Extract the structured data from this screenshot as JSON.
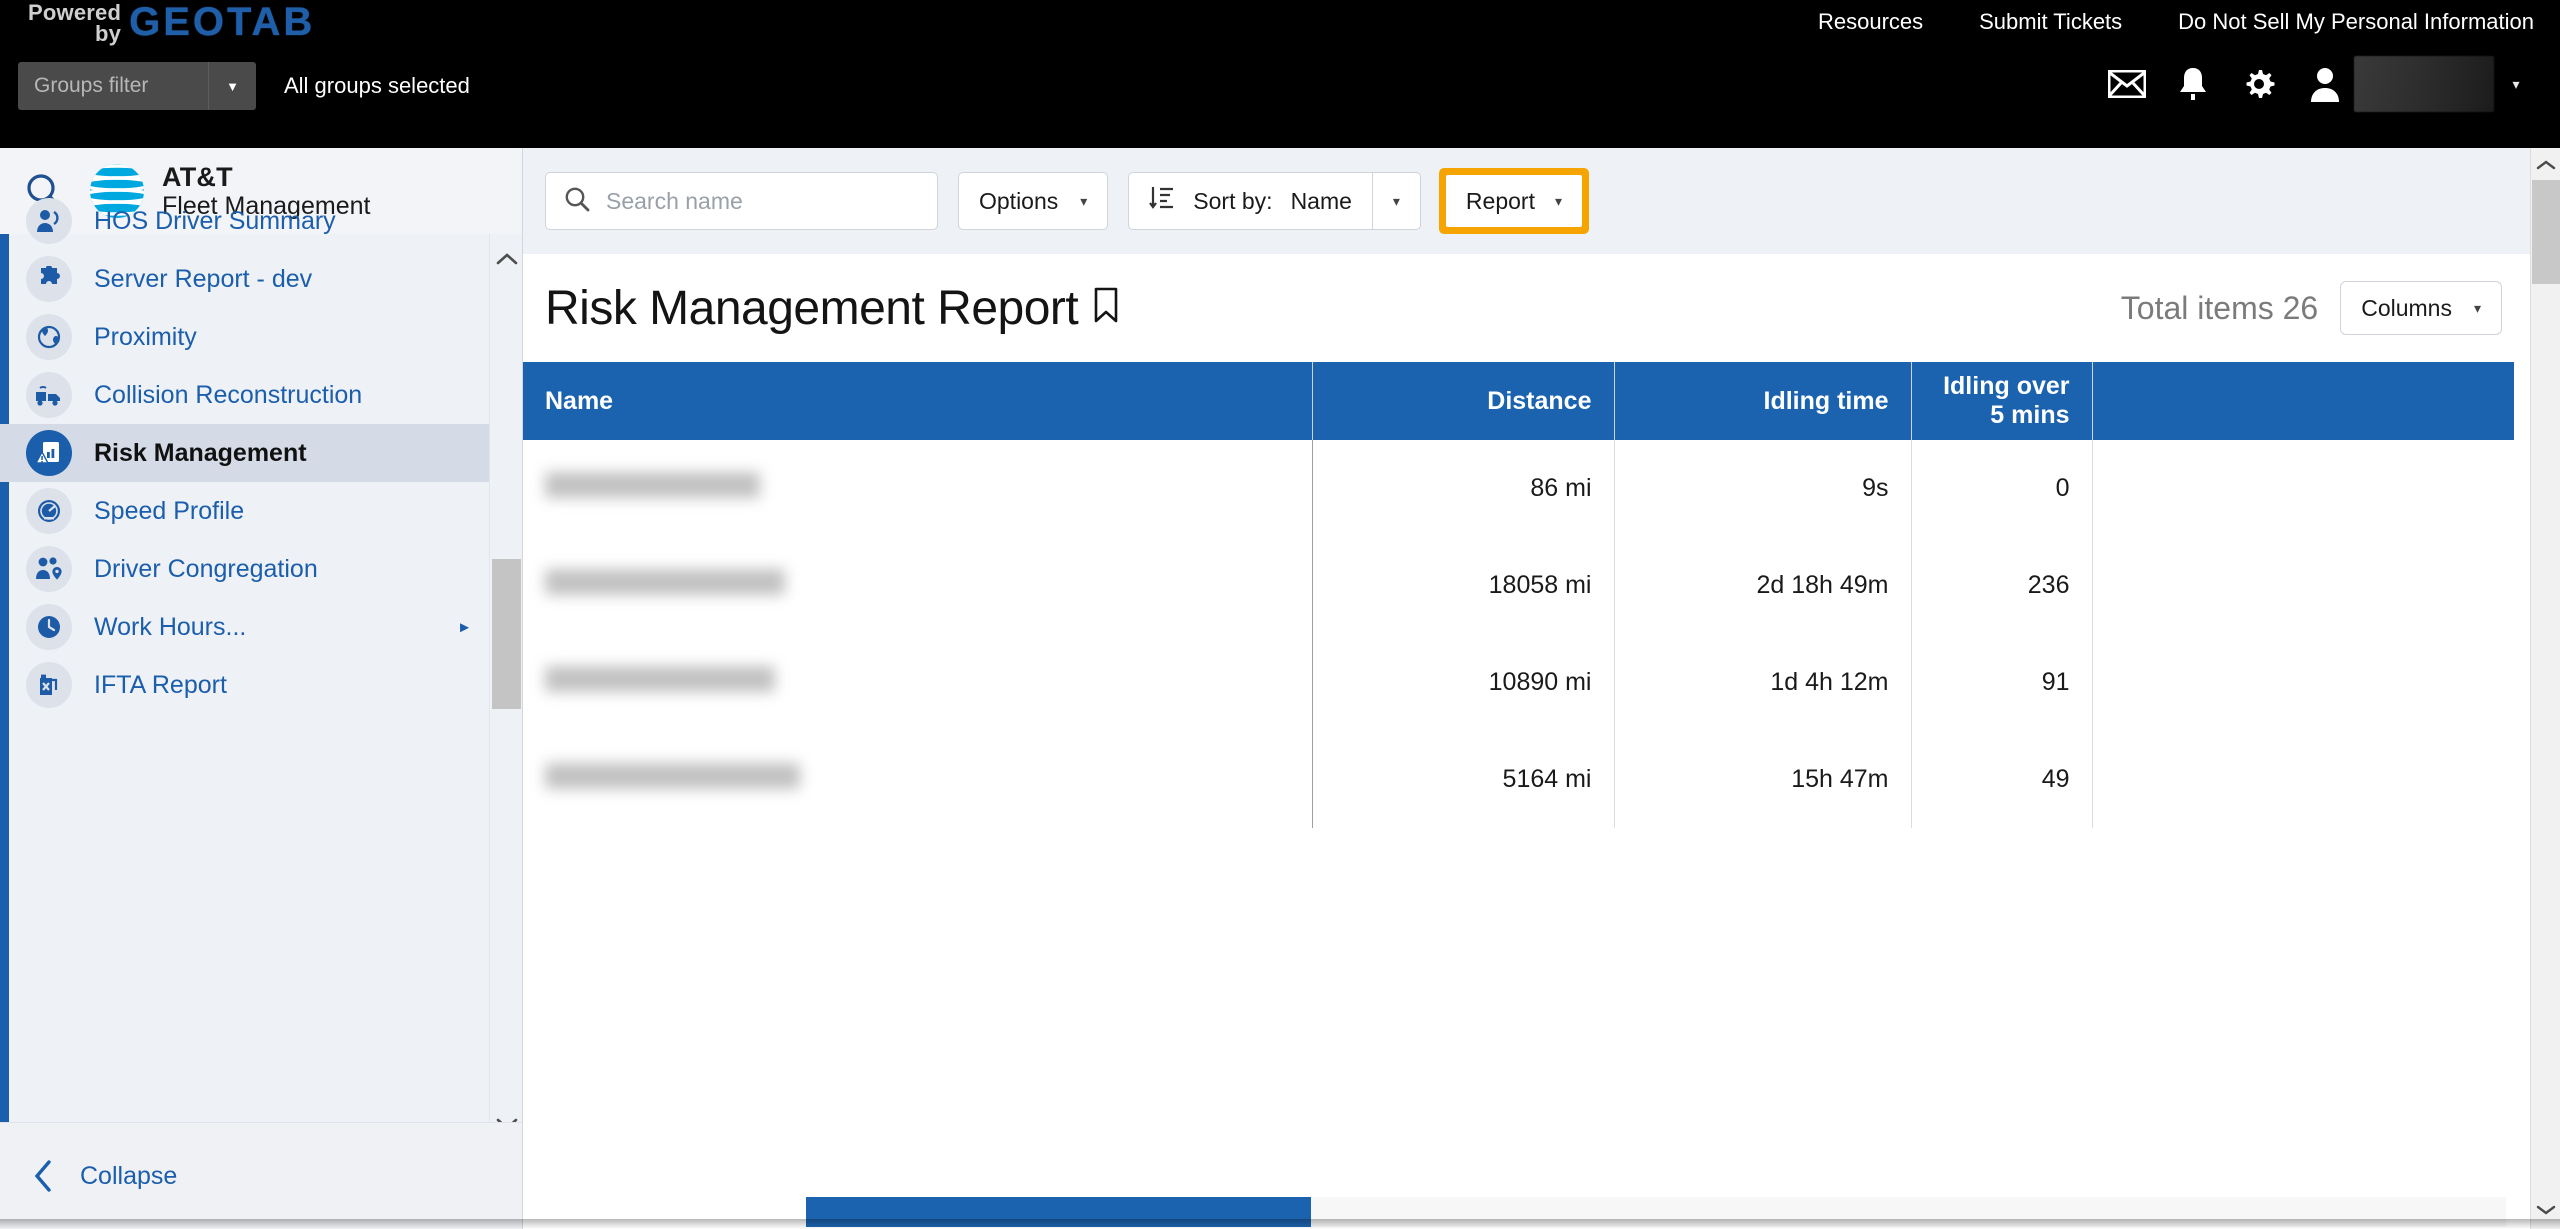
{
  "topbar": {
    "powered_line1": "Powered",
    "powered_line2": "by",
    "brand_logo": "GEOTAB",
    "links": [
      {
        "label": "Resources",
        "name": "resources-link"
      },
      {
        "label": "Submit Tickets",
        "name": "submit-tickets-link"
      },
      {
        "label": "Do Not Sell My Personal Information",
        "name": "do-not-sell-link"
      }
    ],
    "groups_filter_placeholder": "Groups filter",
    "groups_selected_text": "All groups selected",
    "icons": [
      "mail-icon",
      "bell-icon",
      "gear-icon",
      "user-icon"
    ],
    "user_caret": "▾"
  },
  "sidebar": {
    "search_icon": "search-icon",
    "brand_line1": "AT&T",
    "brand_line2": "Fleet Management",
    "items": [
      {
        "label": "HOS Driver Summary",
        "icon": "driver-summary-icon",
        "selected": false,
        "has_submenu": false
      },
      {
        "label": "Server Report - dev",
        "icon": "puzzle-icon",
        "selected": false,
        "has_submenu": false
      },
      {
        "label": "Proximity",
        "icon": "proximity-icon",
        "selected": false,
        "has_submenu": false
      },
      {
        "label": "Collision Reconstruction",
        "icon": "collision-icon",
        "selected": false,
        "has_submenu": false
      },
      {
        "label": "Risk Management",
        "icon": "risk-report-icon",
        "selected": true,
        "has_submenu": false
      },
      {
        "label": "Speed Profile",
        "icon": "speedometer-icon",
        "selected": false,
        "has_submenu": false
      },
      {
        "label": "Driver Congregation",
        "icon": "people-pin-icon",
        "selected": false,
        "has_submenu": false
      },
      {
        "label": "Work Hours...",
        "icon": "clock-icon",
        "selected": false,
        "has_submenu": true
      },
      {
        "label": "IFTA Report",
        "icon": "fuel-can-icon",
        "selected": false,
        "has_submenu": false
      }
    ],
    "collapse_label": "Collapse",
    "collapse_icon": "chevron-left-icon",
    "scroll_up_icon": "chevron-up-icon",
    "scroll_down_icon": "chevron-down-icon"
  },
  "toolbar": {
    "search_placeholder": "Search name",
    "search_value": "",
    "search_icon": "search-icon",
    "options_label": "Options",
    "sort_icon": "sort-descending-icon",
    "sort_label": "Sort by:",
    "sort_value": "Name",
    "report_label": "Report",
    "caret": "▾"
  },
  "page": {
    "title": "Risk Management Report",
    "bookmark_icon": "bookmark-icon",
    "total_items_label": "Total items 26",
    "columns_label": "Columns",
    "highlight_color": "#f5a400",
    "header_color": "#1b63ae"
  },
  "table": {
    "columns": [
      {
        "key": "name",
        "label": "Name",
        "align": "left"
      },
      {
        "key": "distance",
        "label": "Distance",
        "align": "right"
      },
      {
        "key": "idling_time",
        "label": "Idling time",
        "align": "right"
      },
      {
        "key": "idling_over_5",
        "label": "Idling over 5 mins",
        "align": "right"
      },
      {
        "key": "blank",
        "label": "",
        "align": "left"
      }
    ],
    "rows": [
      {
        "name": "",
        "name_redacted": true,
        "name_width": 215,
        "distance": "86 mi",
        "idling_time": "9s",
        "idling_over_5": "0"
      },
      {
        "name": "",
        "name_redacted": true,
        "name_width": 240,
        "distance": "18058 mi",
        "idling_time": "2d 18h 49m",
        "idling_over_5": "236"
      },
      {
        "name": "",
        "name_redacted": true,
        "name_width": 230,
        "distance": "10890 mi",
        "idling_time": "1d 4h 12m",
        "idling_over_5": "91"
      },
      {
        "name": "",
        "name_redacted": true,
        "name_width": 255,
        "distance": "5164 mi",
        "idling_time": "15h 47m",
        "idling_over_5": "49"
      }
    ]
  },
  "scrollbars": {
    "page_up_icon": "chevron-up-icon",
    "page_down_icon": "chevron-down-icon"
  }
}
